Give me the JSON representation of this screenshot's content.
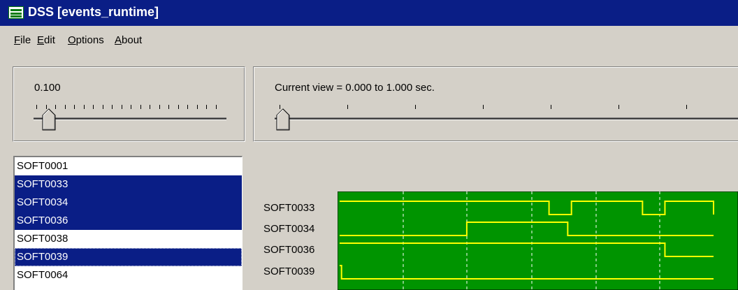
{
  "window": {
    "title": "DSS [events_runtime]"
  },
  "menu": [
    {
      "pre": "",
      "mn": "F",
      "post": "ile"
    },
    {
      "pre": "",
      "mn": "E",
      "post": "dit"
    },
    {
      "pre": "",
      "mn": "O",
      "post": "ptions"
    },
    {
      "pre": "",
      "mn": "A",
      "post": "bout"
    }
  ],
  "scale_slider": {
    "value_label": "0.100"
  },
  "view_slider": {
    "label": "Current view = 0.000 to 1.000 sec."
  },
  "signal_list": {
    "items": [
      {
        "label": "SOFT0001",
        "selected": false
      },
      {
        "label": "SOFT0033",
        "selected": true
      },
      {
        "label": "SOFT0034",
        "selected": true
      },
      {
        "label": "SOFT0036",
        "selected": true
      },
      {
        "label": "SOFT0038",
        "selected": false
      },
      {
        "label": "SOFT0039",
        "selected": true,
        "focused": true
      },
      {
        "label": "SOFT0064",
        "selected": false
      }
    ]
  },
  "timing": {
    "background": "#009400",
    "trace_color": "#ffff00",
    "traces": [
      {
        "name": "SOFT0033",
        "transitions": [
          [
            0,
            "H"
          ],
          [
            0.56,
            "L"
          ],
          [
            0.62,
            "H"
          ],
          [
            0.81,
            "L"
          ],
          [
            0.87,
            "H"
          ],
          [
            1.0,
            "L"
          ]
        ]
      },
      {
        "name": "SOFT0034",
        "transitions": [
          [
            0,
            "L"
          ],
          [
            0.34,
            "H"
          ],
          [
            0.61,
            "L"
          ]
        ]
      },
      {
        "name": "SOFT0036",
        "transitions": [
          [
            0,
            "H"
          ],
          [
            0.87,
            "L"
          ]
        ]
      },
      {
        "name": "SOFT0039",
        "transitions": [
          [
            0,
            "H"
          ],
          [
            0.005,
            "L"
          ]
        ]
      }
    ]
  },
  "colors": {
    "selection": "#0a1e86",
    "face": "#d4d0c8"
  }
}
